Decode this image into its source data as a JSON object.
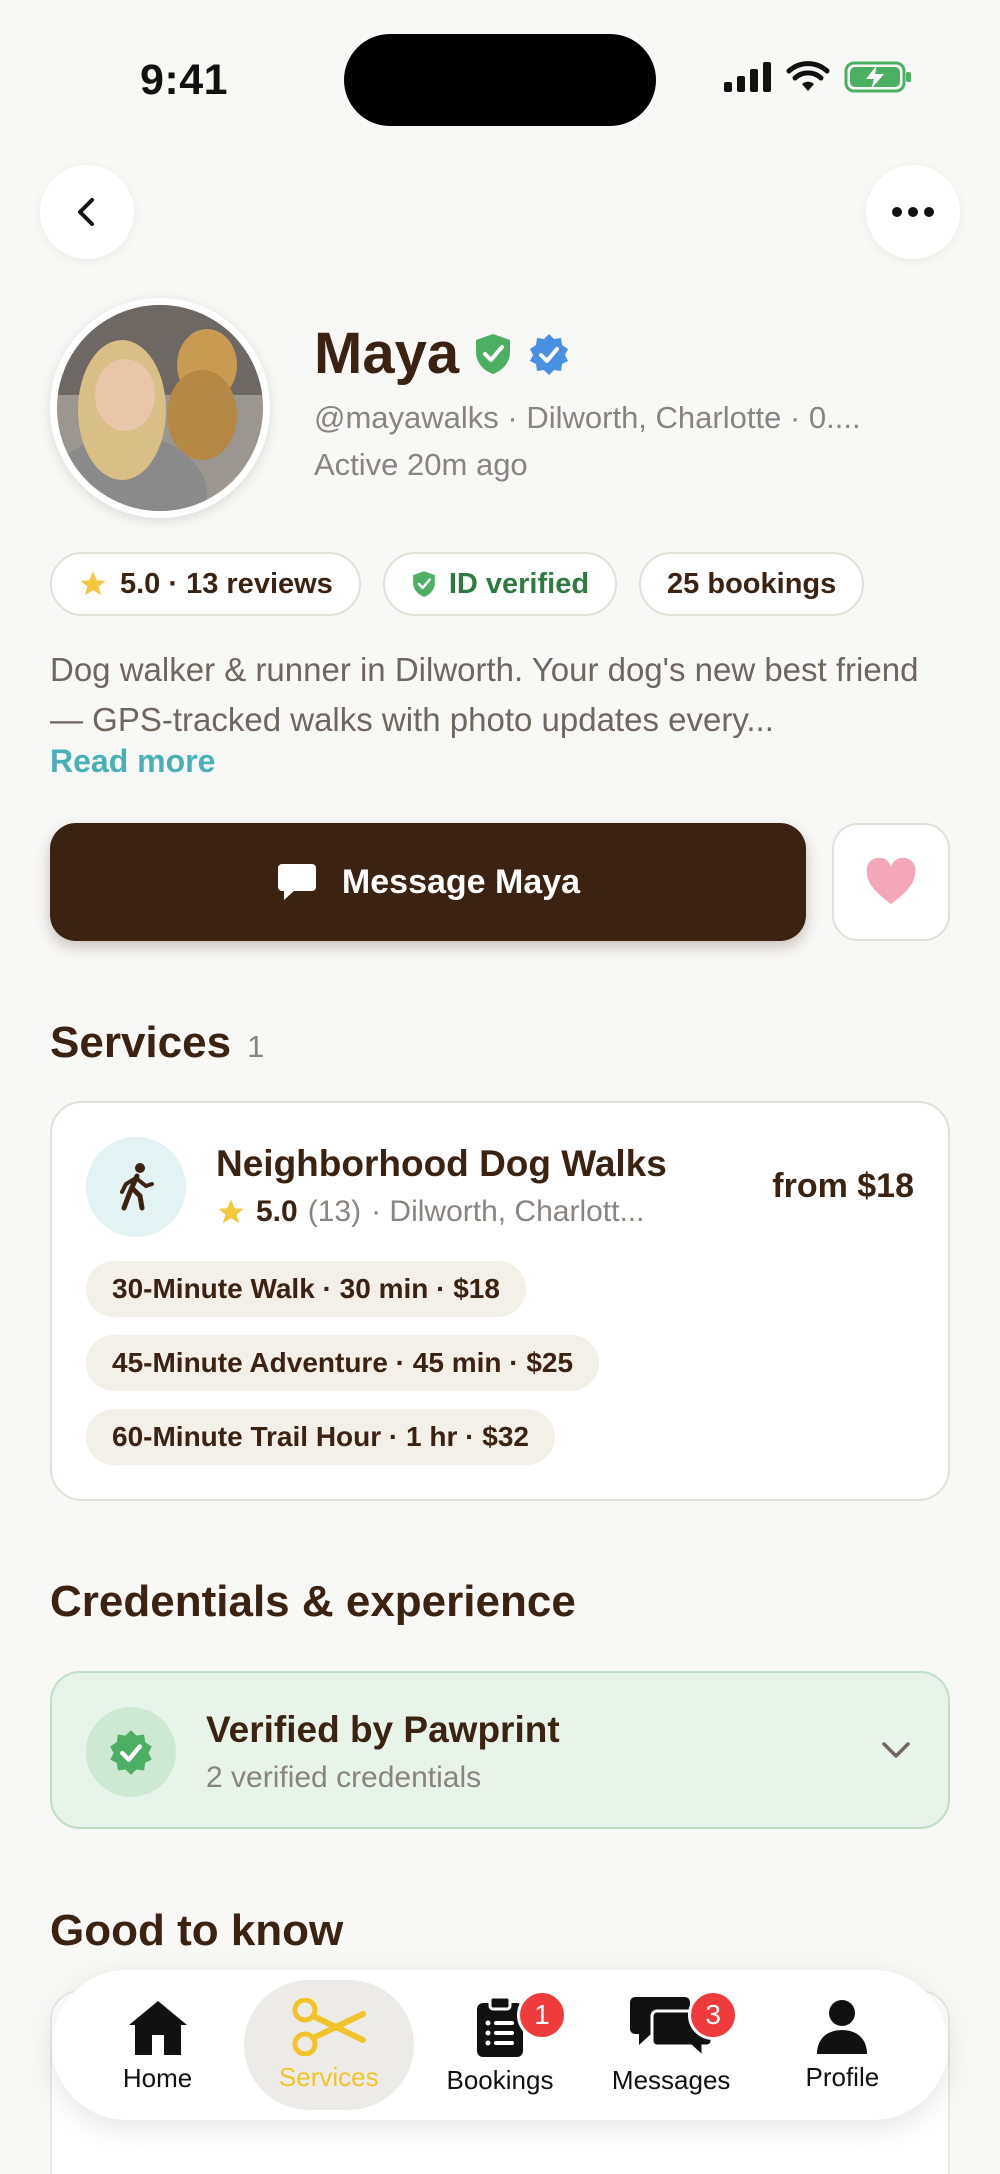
{
  "status": {
    "time": "9:41"
  },
  "profile": {
    "name": "Maya",
    "handle": "@mayawalks · Dilworth, Charlotte · 0....",
    "active": "Active 20m ago",
    "chips": {
      "rating": "5.0 · 13 reviews",
      "id": "ID verified",
      "bookings": "25 bookings"
    },
    "bio": "Dog walker & runner in Dilworth. Your dog's new best friend — GPS-tracked walks with photo updates every...",
    "read_more": "Read more",
    "message_label": "Message Maya"
  },
  "services": {
    "title": "Services",
    "count": "1",
    "card": {
      "name": "Neighborhood Dog Walks",
      "rating": "5.0",
      "reviews": "(13)",
      "location": "· Dilworth, Charlott...",
      "price": "from $18",
      "options": [
        "30-Minute Walk · 30 min · $18",
        "45-Minute Adventure · 45 min · $25",
        "60-Minute Trail Hour · 1 hr · $32"
      ]
    }
  },
  "credentials": {
    "title": "Credentials & experience",
    "card_title": "Verified by Pawprint",
    "card_sub": "2 verified credentials"
  },
  "good_to_know": {
    "title": "Good to know"
  },
  "tabbar": {
    "home": "Home",
    "services": "Services",
    "bookings": "Bookings",
    "bookings_badge": "1",
    "messages": "Messages",
    "messages_badge": "3",
    "profile": "Profile"
  },
  "colors": {
    "brand_brown": "#3b2314",
    "accent_teal": "#4ab0b8",
    "active_tab": "#f3c42a",
    "badge_red": "#ef3b3b",
    "verified_green": "#4caf62"
  }
}
